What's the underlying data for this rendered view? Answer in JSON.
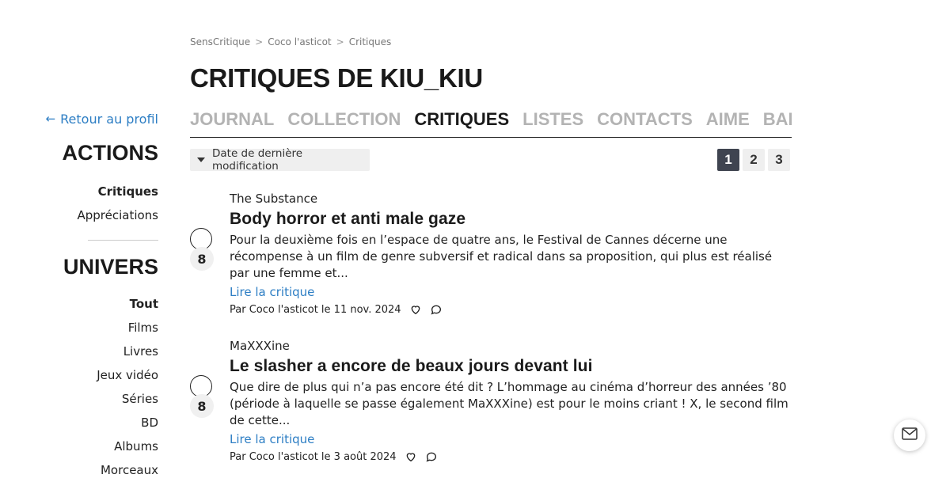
{
  "breadcrumb": [
    "SensCritique",
    "Coco l'asticot",
    "Critiques"
  ],
  "page_title": "CRITIQUES DE KIU_KIU",
  "tabs": [
    {
      "label": "JOURNAL",
      "active": false
    },
    {
      "label": "COLLECTION",
      "active": false
    },
    {
      "label": "CRITIQUES",
      "active": true
    },
    {
      "label": "LISTES",
      "active": false
    },
    {
      "label": "CONTACTS",
      "active": false
    },
    {
      "label": "AIME",
      "active": false
    },
    {
      "label": "BADGES",
      "active": false
    }
  ],
  "sidebar": {
    "back_label": "Retour au profil",
    "actions_title": "ACTIONS",
    "actions": [
      "Critiques",
      "Appréciations"
    ],
    "univers_title": "UNIVERS",
    "univers": [
      "Tout",
      "Films",
      "Livres",
      "Jeux vidéo",
      "Séries",
      "BD",
      "Albums",
      "Morceaux"
    ]
  },
  "sort": {
    "label": "Date de dernière modification"
  },
  "pagination": [
    "1",
    "2",
    "3"
  ],
  "reviews": [
    {
      "rating": "8",
      "movie": "The Substance",
      "title": "Body horror et anti male gaze",
      "excerpt": "Pour la deuxième fois en l’espace de quatre ans, le Festival de Cannes décerne une récompense à un film de genre subversif et radical dans sa proposition, qui plus est réalisé par une femme et...",
      "read_link": "Lire la critique",
      "meta": "Par Coco l'asticot le 11 nov. 2024"
    },
    {
      "rating": "8",
      "movie": "MaXXXine",
      "title": "Le slasher a encore de beaux jours devant lui",
      "excerpt": "Que dire de plus qui n’a pas encore été dit ? L’hommage au cinéma d’horreur des années ’80 (période à laquelle se passe également MaXXXine) est pour le moins criant ! X, le second film de cette...",
      "read_link": "Lire la critique",
      "meta": "Par Coco l'asticot le 3 août 2024"
    }
  ],
  "colors": {
    "link": "#2d7ec4",
    "text": "#1a1a1a",
    "inactive_tab": "#b3b3b3",
    "active_page": "#3f4450"
  },
  "icons": [
    "arrow-left-icon",
    "caret-down-icon",
    "heart-icon",
    "comment-icon",
    "mail-icon"
  ]
}
